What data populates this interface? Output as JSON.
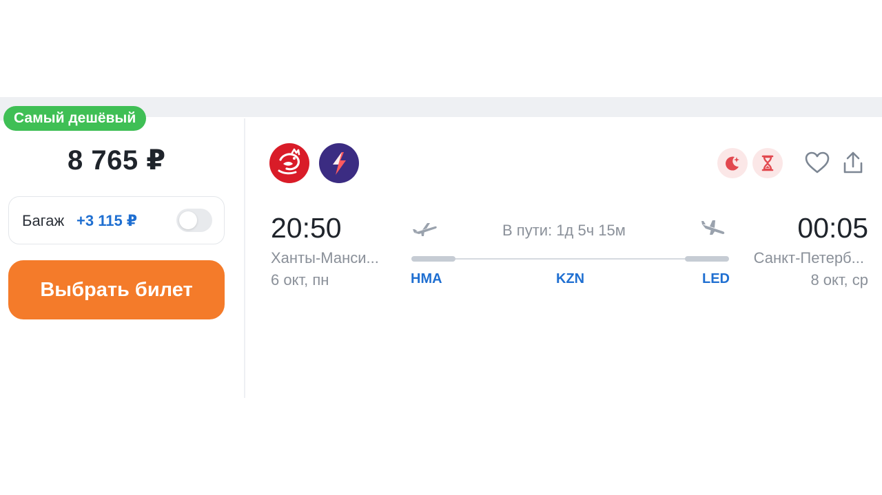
{
  "offer": {
    "badge": "Самый дешёвый",
    "price": "8 765 ₽",
    "baggage": {
      "label": "Багаж",
      "price": "+3 115 ₽",
      "enabled": false
    },
    "select_label": "Выбрать билет"
  },
  "airlines": [
    {
      "icon": "airline-logo-rooster",
      "color": "#d91c28"
    },
    {
      "icon": "airline-logo-lightning",
      "color": "#3b2c82"
    }
  ],
  "flags": [
    {
      "icon": "night-flight-icon",
      "color": "#e2484f"
    },
    {
      "icon": "hourglass-icon",
      "color": "#e2484f"
    }
  ],
  "actions": [
    {
      "icon": "heart-icon"
    },
    {
      "icon": "share-icon"
    }
  ],
  "flight": {
    "departure": {
      "time": "20:50",
      "city": "Ханты-Манси...",
      "date": "6 окт, пн",
      "iata": "HMA"
    },
    "arrival": {
      "time": "00:05",
      "city": "Санкт-Петерб...",
      "date": "8 окт, ср",
      "iata": "LED"
    },
    "duration": "В пути: 1д 5ч 15м",
    "stops": [
      {
        "iata": "KZN"
      }
    ]
  },
  "colors": {
    "badge": "#3fbf55",
    "button": "#f47b2a",
    "accent": "#1f6fd1",
    "muted_text": "#8a9099"
  }
}
